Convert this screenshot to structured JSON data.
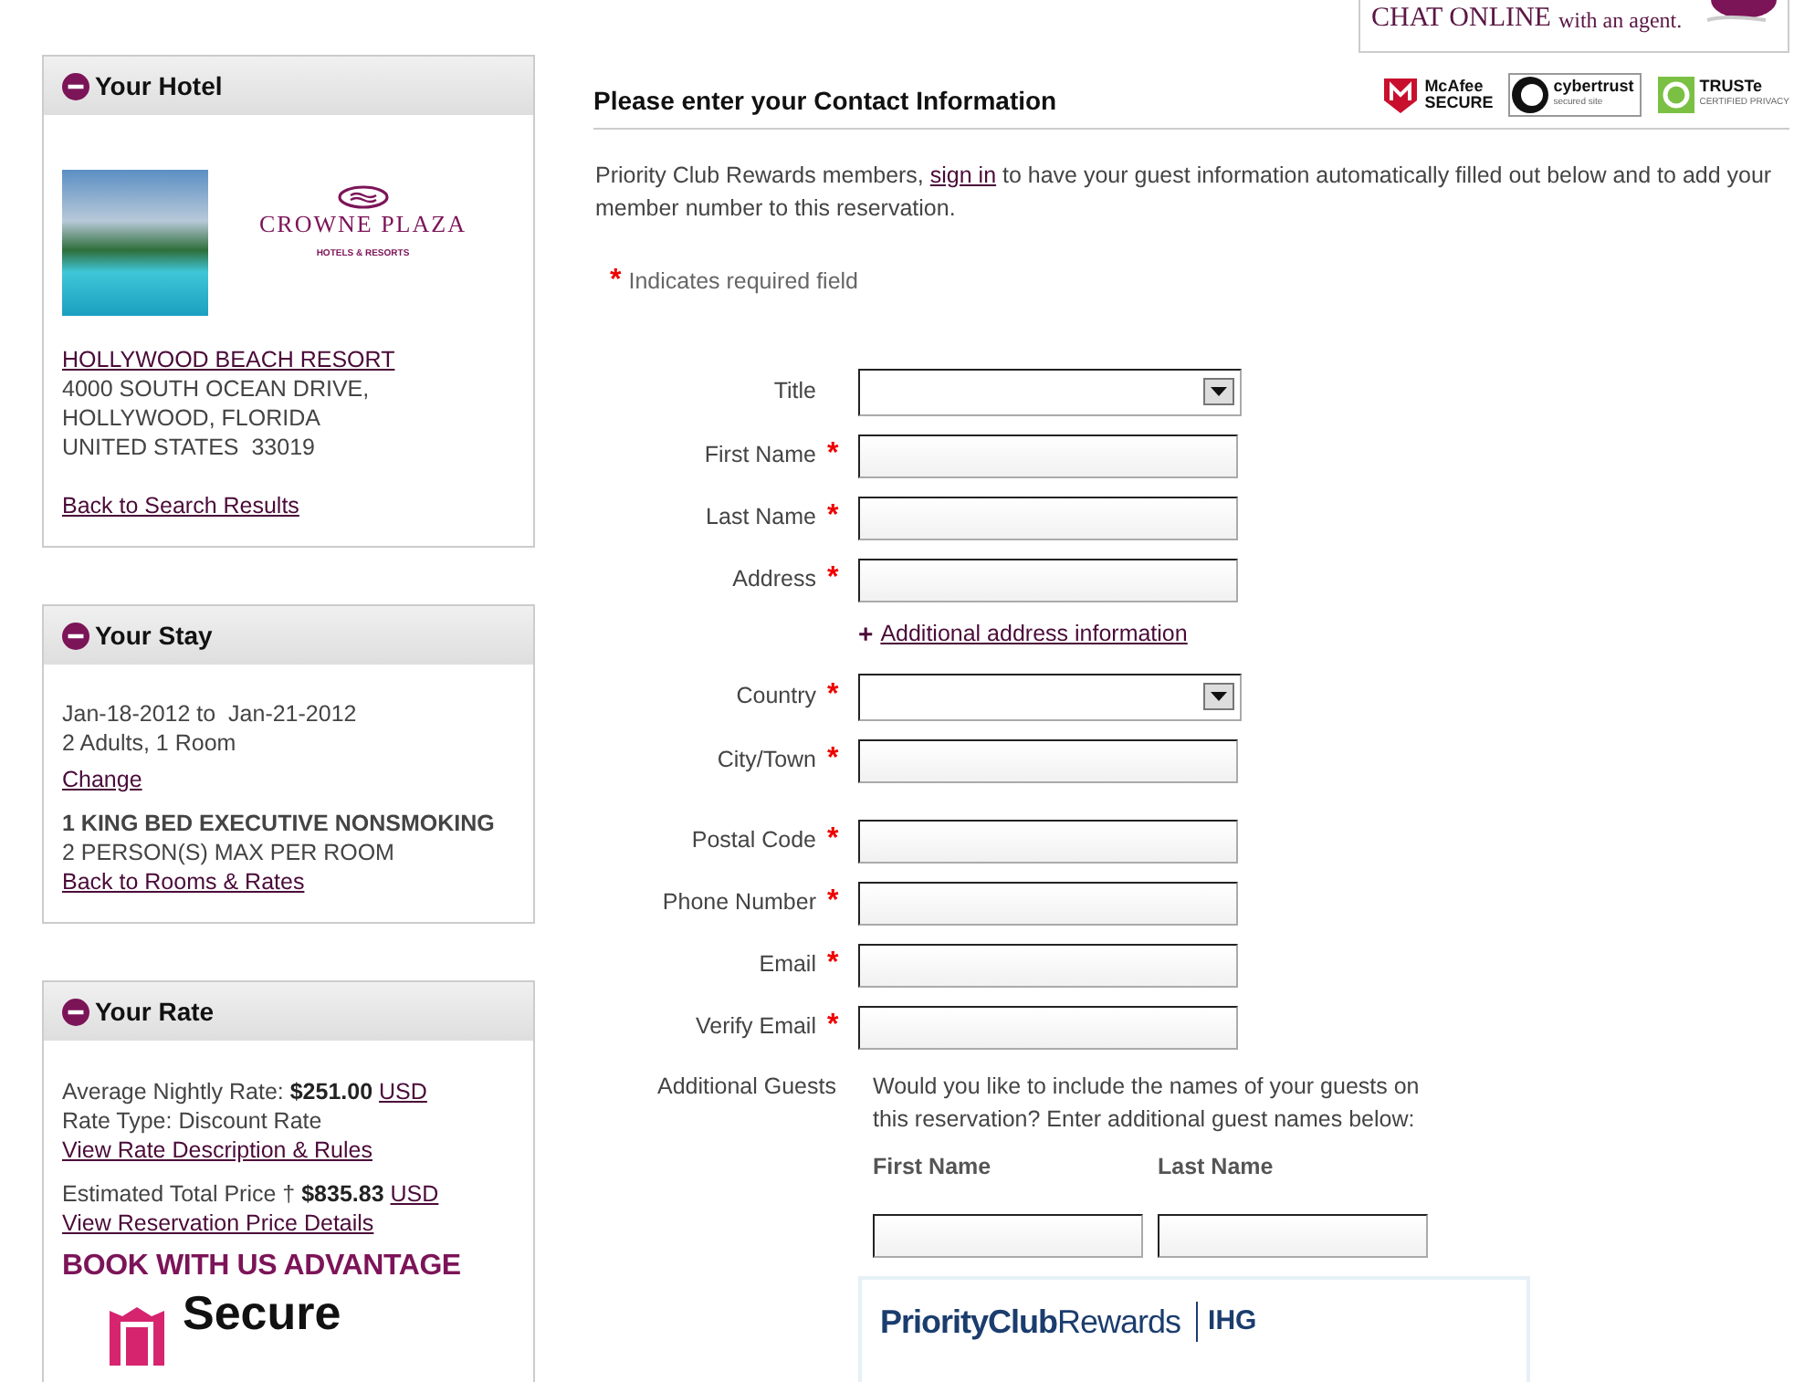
{
  "sidebar": [
    {
      "kind": "hotel",
      "title": "Your Hotel",
      "brand": {
        "name": "CROWNE PLAZA",
        "tagline": "HOTELS & RESORTS"
      },
      "hotel_link": "HOLLYWOOD BEACH RESORT",
      "address": [
        "4000 SOUTH OCEAN DRIVE,",
        "HOLLYWOOD, FLORIDA",
        "UNITED STATES  33019"
      ],
      "back_link": "Back to Search Results"
    },
    {
      "kind": "stay",
      "title": "Your Stay",
      "dates": "Jan-18-2012 to  Jan-21-2012",
      "guests": "2 Adults, 1 Room",
      "change_link": "Change",
      "room": "1 KING BED EXECUTIVE NONSMOKING",
      "occupancy": "2 PERSON(S) MAX PER ROOM",
      "back_link": "Back to Rooms & Rates"
    },
    {
      "kind": "rate",
      "title": "Your Rate",
      "nightly": {
        "label": "Average Nightly Rate: ",
        "amount": "$251.00",
        "currency": "USD"
      },
      "rate_type": "Rate Type: Discount Rate",
      "rules_link": "View Rate Description & Rules",
      "total": {
        "label": "Estimated Total Price † ",
        "amount": "$835.83",
        "currency": "USD"
      },
      "details_link": "View Reservation Price Details",
      "advantage": "BOOK WITH US ADVANTAGE",
      "secure": "Secure"
    }
  ],
  "chat": {
    "title": "CHAT ONLINE",
    "subtitle": "with an agent."
  },
  "heading": "Please enter your Contact Information",
  "badges": [
    {
      "kind": "mcafee",
      "lines": [
        "McAfee",
        "SECURE"
      ]
    },
    {
      "kind": "cybertrust",
      "lines": [
        "cybertrust",
        "secured site"
      ]
    },
    {
      "kind": "truste",
      "lines": [
        "TRUSTe",
        "CERTIFIED PRIVACY"
      ]
    }
  ],
  "intro": {
    "before": "Priority Club Rewards members, ",
    "link": "sign in",
    "after": " to have your guest information automatically filled out below and to add your member number to this reservation."
  },
  "required_note": {
    "mark": "*",
    "text": "Indicates required field"
  },
  "fields": [
    {
      "kind": "select",
      "label": "Title",
      "required": false
    },
    {
      "kind": "input",
      "label": "First Name",
      "required": true
    },
    {
      "kind": "input",
      "label": "Last Name",
      "required": true
    },
    {
      "kind": "input",
      "label": "Address",
      "required": true
    },
    {
      "kind": "link",
      "icon": "+",
      "label": "Additional address information"
    },
    {
      "kind": "select",
      "label": "Country",
      "required": true
    },
    {
      "kind": "input",
      "label": "City/Town",
      "required": true
    },
    {
      "kind": "input",
      "label": "Postal Code",
      "required": true
    },
    {
      "kind": "input",
      "label": "Phone Number",
      "required": true
    },
    {
      "kind": "input",
      "label": "Email",
      "required": true
    },
    {
      "kind": "input",
      "label": "Verify Email",
      "required": true
    }
  ],
  "additional_guests": {
    "label": "Additional Guests",
    "question": "Would you like to include the names of your guests on this reservation? Enter additional guest names below:",
    "columns": [
      "First Name",
      "Last Name"
    ]
  },
  "rewards": {
    "logo": "**PriorityClub**Rewards",
    "brand": "IHG"
  }
}
